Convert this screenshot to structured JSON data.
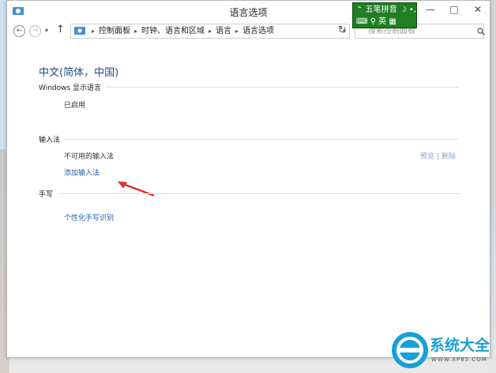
{
  "window": {
    "title": "语言选项",
    "minimize": "—",
    "maximize": "□",
    "close": "✕"
  },
  "address": {
    "crumbs": [
      "控制面板",
      "时钟、语言和区域",
      "语言",
      "语言选项"
    ],
    "search_placeholder": "搜索控制面板"
  },
  "ime": {
    "row1": "五笔拼音",
    "row2": "英"
  },
  "content": {
    "language_title": "中文(简体，中国)",
    "display_section": {
      "heading": "Windows 显示语言",
      "status": "已启用"
    },
    "input_section": {
      "heading": "输入法",
      "unavailable": "不可用的输入法",
      "preview_link": "预览",
      "remove_link": "删除",
      "add_link": "添加输入法"
    },
    "handwriting_section": {
      "heading": "手写",
      "personalize_link": "个性化手写识别"
    }
  },
  "watermark": {
    "brand": "系统大全",
    "url": "WWW.XP85.COM"
  },
  "colors": {
    "link": "#1f5fb0",
    "title": "#1e4f8c",
    "ime_bg": "#1f7f22",
    "arrow": "#d8312b",
    "watermark": "#17a0d8"
  }
}
